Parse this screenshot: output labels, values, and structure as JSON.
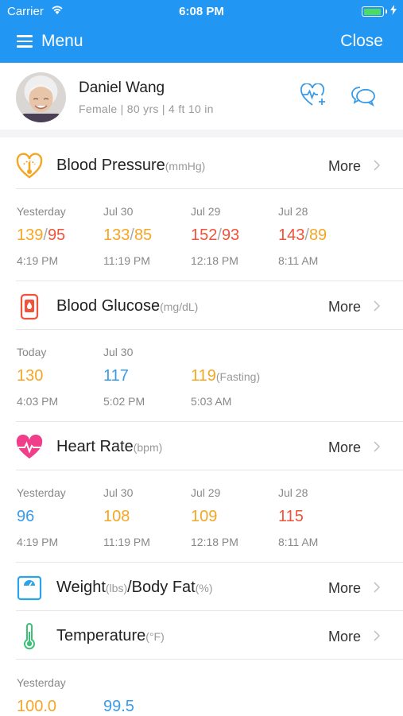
{
  "status_bar": {
    "carrier": "Carrier",
    "time": "6:08 PM"
  },
  "nav": {
    "menu_label": "Menu",
    "close_label": "Close"
  },
  "profile": {
    "name": "Daniel Wang",
    "info": "Female | 80 yrs | 4 ft 10 in"
  },
  "colors": {
    "header_blue": "#2196f3",
    "orange": "#f5a623",
    "red": "#f0533a",
    "blue": "#3a9be8",
    "heart_pink": "#f03e8a",
    "glucose_red": "#f0533a",
    "weight_blue": "#2aa3e8",
    "thermo_green": "#3fbf77"
  },
  "sections": {
    "bp": {
      "icon": "heart-pressure-icon",
      "title": "Blood Pressure",
      "unit": "(mmHg)",
      "more": "More",
      "readings": [
        {
          "date": "Yesterday",
          "sys": "139",
          "dia": "95",
          "time": "4:19 PM"
        },
        {
          "date": "Jul 30",
          "sys": "133",
          "dia": "85",
          "time": "11:19 PM"
        },
        {
          "date": "Jul 29",
          "sys": "152",
          "dia": "93",
          "time": "12:18 PM"
        },
        {
          "date": "Jul 28",
          "sys": "143",
          "dia": "89",
          "time": "8:11 AM"
        }
      ]
    },
    "glucose": {
      "icon": "glucose-meter-icon",
      "title": "Blood Glucose",
      "unit": "(mg/dL)",
      "more": "More",
      "readings": [
        {
          "date": "Today",
          "value": "130",
          "note": "",
          "time": "4:03 PM"
        },
        {
          "date": "Jul 30",
          "value": "117",
          "note": "",
          "time": "5:02 PM"
        },
        {
          "date": "",
          "value": "119",
          "note": "(Fasting)",
          "time": "5:03 AM"
        }
      ]
    },
    "hr": {
      "icon": "heart-pulse-icon",
      "title": "Heart Rate",
      "unit": "(bpm)",
      "more": "More",
      "readings": [
        {
          "date": "Yesterday",
          "value": "96",
          "time": "4:19 PM"
        },
        {
          "date": "Jul 30",
          "value": "108",
          "time": "11:19 PM"
        },
        {
          "date": "Jul 29",
          "value": "109",
          "time": "12:18 PM"
        },
        {
          "date": "Jul 28",
          "value": "115",
          "time": "8:11 AM"
        }
      ]
    },
    "weight": {
      "icon": "scale-icon",
      "title": "Weight",
      "unit1": "(lbs)",
      "title2": "/Body Fat",
      "unit2": "(%)",
      "more": "More"
    },
    "temp": {
      "icon": "thermometer-icon",
      "title": "Temperature",
      "unit": "(°F)",
      "more": "More",
      "readings": [
        {
          "date": "Yesterday",
          "value": "100.0"
        },
        {
          "date": "",
          "value": "99.5"
        }
      ]
    }
  }
}
